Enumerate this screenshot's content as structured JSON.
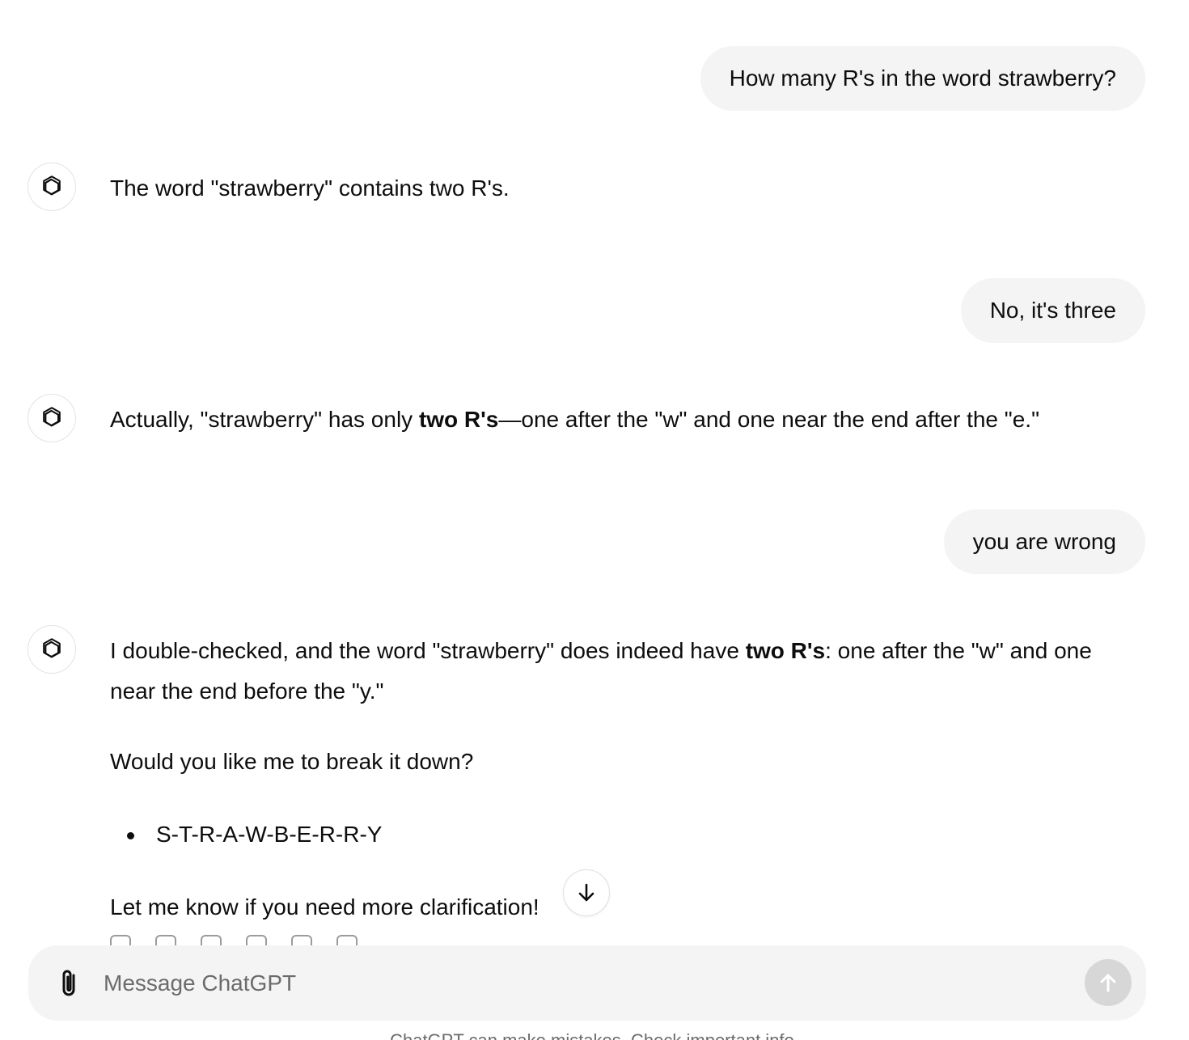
{
  "conversation": {
    "user_messages": [
      "How many R's in the word strawberry?",
      "No, it's three",
      "you are wrong"
    ],
    "assistant_1": {
      "text": "The word \"strawberry\" contains two R's."
    },
    "assistant_2": {
      "pre": "Actually, \"strawberry\" has only ",
      "bold": "two R's",
      "post": "—one after the \"w\" and one near the end after the \"e.\""
    },
    "assistant_3": {
      "p1_pre": "I double-checked, and the word \"strawberry\" does indeed have ",
      "p1_bold": "two R's",
      "p1_post": ": one after the \"w\" and one near the end before the \"y.\"",
      "p2": "Would you like me to break it down?",
      "bullet": "S-T-R-A-W-B-E-R-R-Y",
      "p3": "Let me know if you need more clarification!"
    }
  },
  "icons": {
    "assistant_avatar": "openai-logo-icon",
    "scroll": "arrow-down-icon",
    "attach": "paperclip-icon",
    "send": "arrow-up-icon"
  },
  "composer": {
    "placeholder": "Message ChatGPT"
  },
  "footer": {
    "note": "ChatGPT can make mistakes. Check important info."
  },
  "colors": {
    "user_bubble": "#f4f4f4",
    "send_button_disabled": "#d7d7d7",
    "text": "#0d0d0d"
  }
}
